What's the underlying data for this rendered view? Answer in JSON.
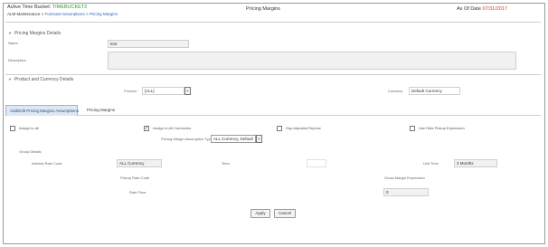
{
  "header": {
    "bucket_label": "Active Time Bucket:",
    "bucket_value": "TIMEBUCKET2",
    "breadcrumb_root": "ALM Maintenance",
    "breadcrumb_sep": ">",
    "breadcrumb_link1": "Forecast Assumptions",
    "breadcrumb_link2": "Pricing Margins",
    "page_title": "Pricing Margins",
    "as_of_label": "As Of Date",
    "as_of_value": "07/31/2017"
  },
  "details": {
    "title": "Pricing Margins Details",
    "name_label": "Name",
    "name_value": "test",
    "description_label": "Description",
    "description_value": ""
  },
  "product": {
    "title": "Product and Currency Details",
    "product_label": "Product",
    "product_value": "[ALL]",
    "currency_label": "Currency",
    "currency_value": "Default Currency"
  },
  "tabs": {
    "tab1": "Add/Edit Pricing Margins Assumptions",
    "tab2": "Pricing Margins"
  },
  "options": {
    "opt1": "Assign to all",
    "opt2": "Assign to All Currencies",
    "opt3": "Gap Adjusted Reprice",
    "opt4": "Use Rate Pickup Expression",
    "assumption_label": "Pricing Margin Assumption Type",
    "assumption_value": "ALL Currency, Default"
  },
  "group": {
    "title": "Group Details",
    "interest_label": "Interest Rate Code",
    "interest_value": "ALL Currency",
    "term_label": "Term",
    "term_value": "",
    "unit_label": "Unit Time",
    "unit_value": "3 Months",
    "pickup_label": "Pickup Rate Code",
    "gross_label": "Gross Margin Expression",
    "rate_label": "Rate Floor",
    "rate_value": "0"
  },
  "footer": {
    "apply_label": "Apply",
    "cancel_label": "Cancel"
  },
  "colors": {
    "accent_green": "#2e9a2e",
    "link_blue": "#2a64b4",
    "date_red": "#d23c3c",
    "tab_active_bg": "#dde8f4"
  }
}
